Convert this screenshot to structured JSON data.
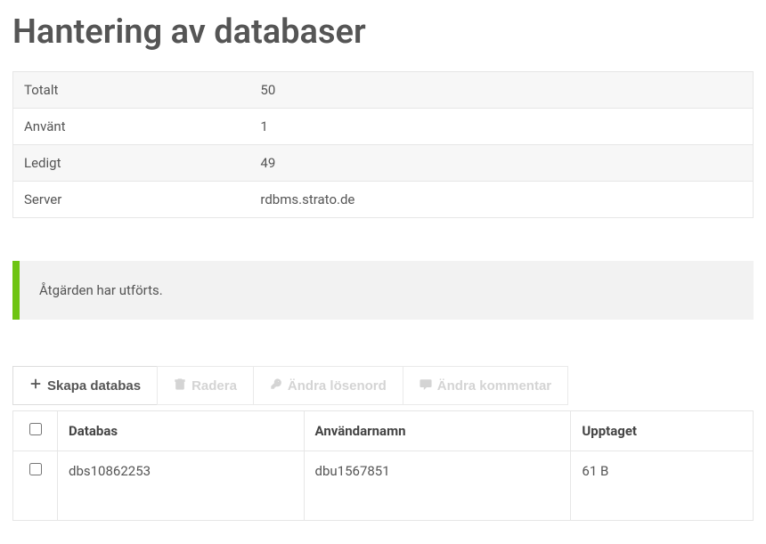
{
  "page_title": "Hantering av databaser",
  "info": [
    {
      "label": "Totalt",
      "value": "50"
    },
    {
      "label": "Använt",
      "value": "1"
    },
    {
      "label": "Ledigt",
      "value": "49"
    },
    {
      "label": "Server",
      "value": "rdbms.strato.de"
    }
  ],
  "alert_message": "Åtgärden har utförts.",
  "toolbar": {
    "create": "Skapa databas",
    "delete": "Radera",
    "change_password": "Ändra lösenord",
    "change_comment": "Ändra kommentar"
  },
  "table": {
    "headers": {
      "database": "Databas",
      "username": "Användarnamn",
      "used": "Upptaget"
    },
    "rows": [
      {
        "database": "dbs10862253",
        "username": "dbu1567851",
        "used": "61 B"
      }
    ]
  }
}
